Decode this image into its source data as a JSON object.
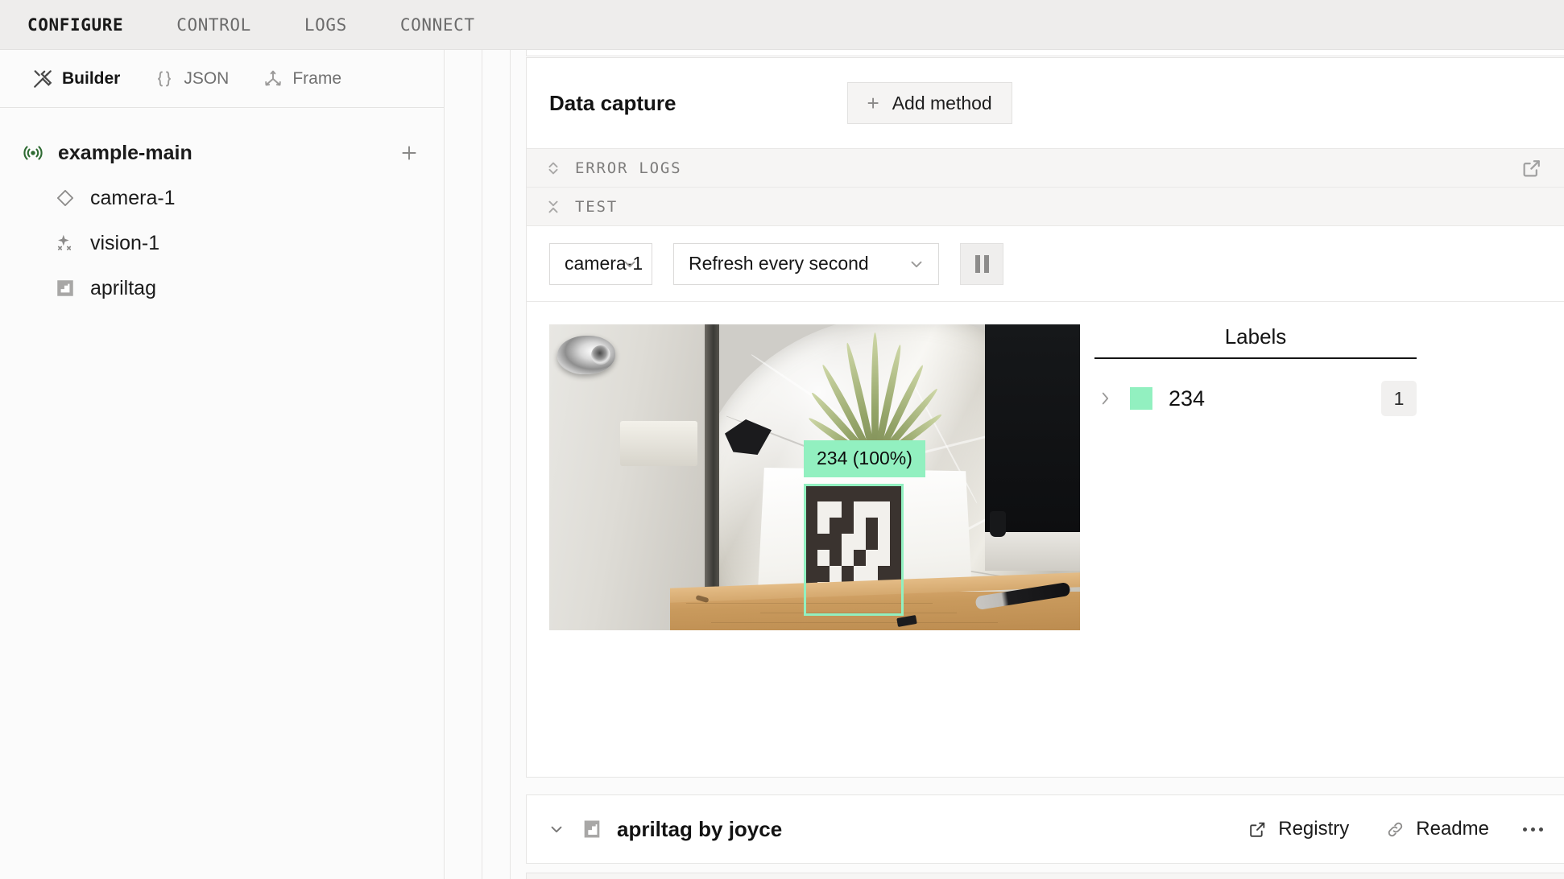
{
  "top_nav": {
    "tabs": [
      {
        "label": "CONFIGURE",
        "active": true
      },
      {
        "label": "CONTROL",
        "active": false
      },
      {
        "label": "LOGS",
        "active": false
      },
      {
        "label": "CONNECT",
        "active": false
      }
    ]
  },
  "sidebar": {
    "tabs": [
      {
        "label": "Builder",
        "icon": "tools-icon",
        "active": true
      },
      {
        "label": "JSON",
        "icon": "braces-icon",
        "active": false
      },
      {
        "label": "Frame",
        "icon": "axes-icon",
        "active": false
      }
    ],
    "tree": {
      "root": {
        "label": "example-main",
        "icon": "machine-signal-icon",
        "add_icon": "plus-icon"
      },
      "children": [
        {
          "label": "camera-1",
          "icon": "diamond-icon"
        },
        {
          "label": "vision-1",
          "icon": "sparkle-vision-icon"
        },
        {
          "label": "apriltag",
          "icon": "apriltag-icon"
        }
      ]
    }
  },
  "main": {
    "data_capture": {
      "title": "Data capture",
      "add_method_label": "Add method",
      "add_method_icon": "plus-icon"
    },
    "sections": [
      {
        "label": "ERROR LOGS",
        "expanded": false,
        "toggle_icon": "expand-vertical-icon",
        "action_icon": "external-link-icon"
      },
      {
        "label": "TEST",
        "expanded": true,
        "toggle_icon": "collapse-vertical-icon"
      }
    ],
    "test": {
      "camera_select": {
        "value": "camera-1",
        "chevron": "chevron-down-icon"
      },
      "refresh_select": {
        "value": "Refresh every second",
        "chevron": "chevron-down-icon"
      },
      "pause_button": {
        "icon": "pause-icon"
      },
      "labels_panel": {
        "title": "Labels",
        "rows": [
          {
            "expand_icon": "chevron-right-icon",
            "color": "#92f0c0",
            "name": "234",
            "count": "1"
          }
        ]
      },
      "detection": {
        "label_text": "234 (100%)",
        "box_color": "#92f0c0",
        "label_bg": "#92f0c0",
        "label_fg": "#0d0d0d"
      }
    },
    "module_card": {
      "collapse_icon": "chevron-down-icon",
      "icon": "apriltag-icon",
      "title": "apriltag by joyce",
      "actions": [
        {
          "label": "Registry",
          "icon": "external-link-icon"
        },
        {
          "label": "Readme",
          "icon": "link-chain-icon"
        }
      ],
      "more_icon": "ellipsis-icon"
    }
  },
  "colors": {
    "accent_green": "#92f0c0",
    "machine_icon_green": "#2f6b33",
    "top_bar_bg": "#eeedec",
    "panel_bg": "#fbfbfb"
  }
}
